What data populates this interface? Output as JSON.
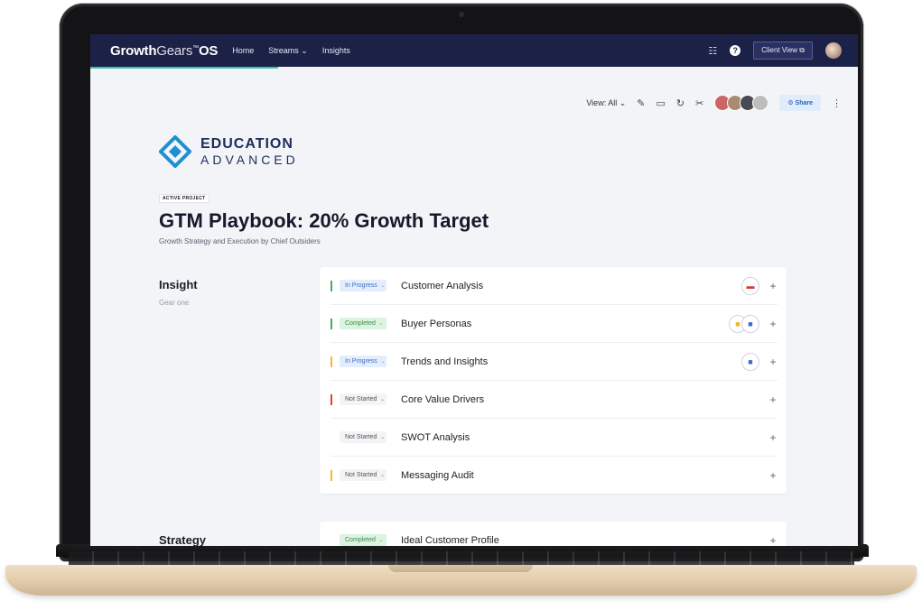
{
  "nav": {
    "brand_bold": "Growth",
    "brand_light": "Gears",
    "brand_tm": "™",
    "brand_suffix": "OS",
    "links": [
      "Home",
      "Streams ⌄",
      "Insights"
    ],
    "client_view": "Client View ⧉"
  },
  "toolbar": {
    "view_label": "View: All ⌄",
    "share_label": "⚙ Share"
  },
  "logo": {
    "line1": "EDUCATION",
    "line2": "ADVANCED"
  },
  "project": {
    "badge": "ACTIVE PROJECT",
    "title": "GTM Playbook: 20% Growth Target",
    "subtitle": "Growth Strategy and Execution by Chief Outsiders"
  },
  "sections": [
    {
      "label": "Insight",
      "sub": "Gear one",
      "rows": [
        {
          "status": "In Progress",
          "title": "Customer Analysis",
          "bar": "#3fae62"
        },
        {
          "status": "Completed",
          "title": "Buyer Personas",
          "bar": "#3fae62"
        },
        {
          "status": "In Progress",
          "title": "Trends and Insights",
          "bar": "#f2b83a"
        },
        {
          "status": "Not Started",
          "title": "Core Value Drivers",
          "bar": "#d9403e"
        },
        {
          "status": "Not Started",
          "title": "SWOT Analysis",
          "bar": ""
        },
        {
          "status": "Not Started",
          "title": "Messaging Audit",
          "bar": "#f2b83a"
        }
      ]
    },
    {
      "label": "Strategy",
      "rows": [
        {
          "status": "Completed",
          "title": "Ideal Customer Profile"
        }
      ]
    }
  ],
  "icons": {
    "pdf": "pdf-file-icon",
    "doc": "doc-file-icon",
    "folder": "folder-file-icon"
  },
  "colors": {
    "nav_bg": "#1c2148",
    "accent": "#3ec1a8",
    "in_progress": "#3d6cc4",
    "completed": "#3c8a48"
  }
}
